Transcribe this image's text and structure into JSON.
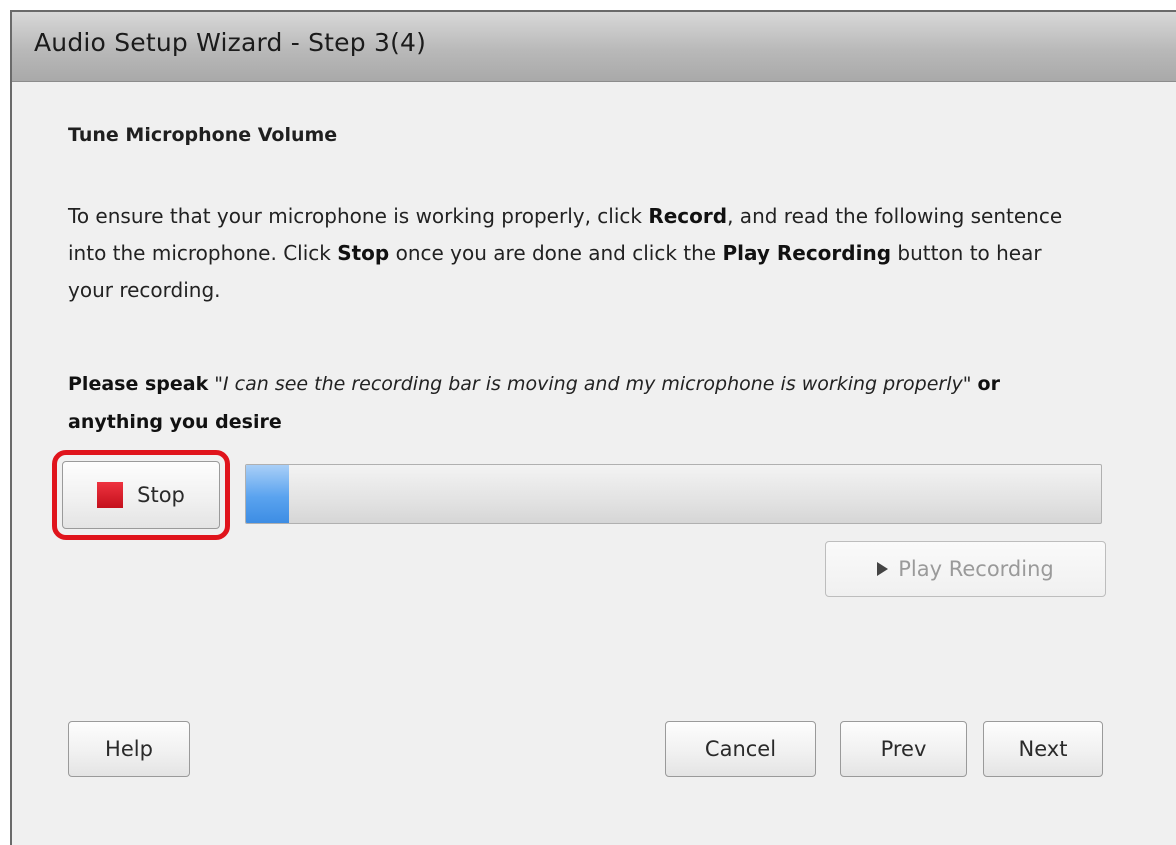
{
  "dialog": {
    "title": "Audio Setup Wizard - Step 3(4)",
    "heading": "Tune Microphone Volume",
    "instructions": {
      "part1": "To ensure that your microphone is working properly, click ",
      "record": "Record",
      "part2": ", and read the following sentence into the microphone. Click ",
      "stop": "Stop",
      "part3": " once you are done and click the ",
      "play": "Play Recording",
      "part4": " button to hear your recording."
    },
    "prompt": {
      "lead": "Please speak",
      "quote": "\"I can see the recording bar is moving and my microphone is working properly\"",
      "tail": "or anything you desire"
    },
    "stop_button": {
      "label": "Stop",
      "icon": "stop-square-icon",
      "color": "#d9141f"
    },
    "level_meter": {
      "level_fraction": 0.05,
      "color": "#4a97ea"
    },
    "play_button": {
      "label": "Play Recording",
      "icon": "play-icon",
      "enabled": false
    },
    "footer": {
      "help_label": "Help",
      "cancel_label": "Cancel",
      "prev_label": "Prev",
      "next_label": "Next"
    },
    "highlight_color": "#e0141c"
  }
}
